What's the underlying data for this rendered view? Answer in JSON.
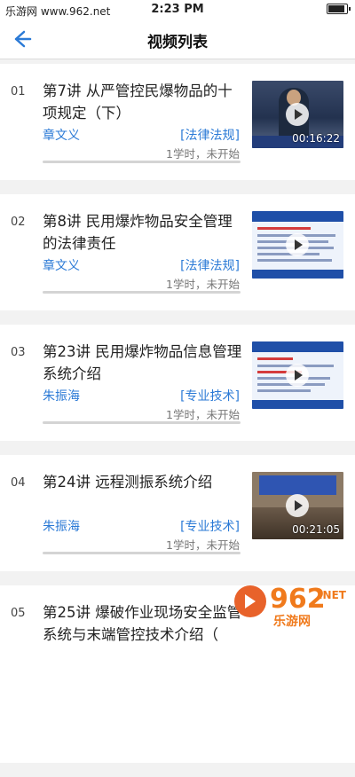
{
  "status_bar": {
    "carrier": "乐游网 www.962.net",
    "time": "2:23 PM"
  },
  "nav": {
    "title": "视频列表",
    "back_icon": "arrow-left-icon"
  },
  "videos": [
    {
      "index": "01",
      "title": "第7讲 从严管控民爆物品的十项规定（下）",
      "author": "章文义",
      "tag": "[法律法规]",
      "meta": "1学时，未开始",
      "duration": "00:16:22"
    },
    {
      "index": "02",
      "title": "第8讲 民用爆炸物品安全管理的法律责任",
      "author": "章文义",
      "tag": "[法律法规]",
      "meta": "1学时，未开始",
      "duration": ""
    },
    {
      "index": "03",
      "title": "第23讲 民用爆炸物品信息管理系统介绍",
      "author": "朱振海",
      "tag": "[专业技术]",
      "meta": "1学时，未开始",
      "duration": ""
    },
    {
      "index": "04",
      "title": "第24讲 远程测振系统介绍",
      "author": "朱振海",
      "tag": "[专业技术]",
      "meta": "1学时，未开始",
      "duration": "00:21:05"
    },
    {
      "index": "05",
      "title": "第25讲 爆破作业现场安全监管系统与末端管控技术介绍（",
      "author": "",
      "tag": "",
      "meta": "",
      "duration": ""
    }
  ],
  "watermark": {
    "number": "962",
    "suffix": ".NET",
    "site": "乐游网"
  }
}
